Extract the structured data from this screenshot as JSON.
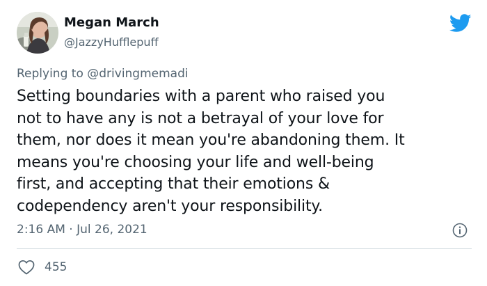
{
  "tweet": {
    "author_name": "Megan March",
    "author_handle": "@JazzyHufflepuff",
    "avatar_icon": "profile-photo",
    "platform_icon": "twitter-bird-icon",
    "replying_prefix": "Replying to",
    "replying_to": "@drivingmemadi",
    "body_lines": [
      "Setting boundaries with a parent who raised you",
      "not to have any is not a betrayal of your love for",
      "them, nor does it mean you're abandoning them. It",
      "means you're choosing your life and well-being",
      "first, and accepting that their emotions &",
      "codependency aren't your responsibility."
    ],
    "timestamp": "2:16 AM · Jul 26, 2021",
    "likes": "455",
    "info_icon": "info-icon",
    "like_icon": "heart-icon"
  },
  "colors": {
    "text": "#0f1419",
    "muted": "#536471",
    "brand": "#1d9bf0",
    "divider": "#cfd9de"
  }
}
